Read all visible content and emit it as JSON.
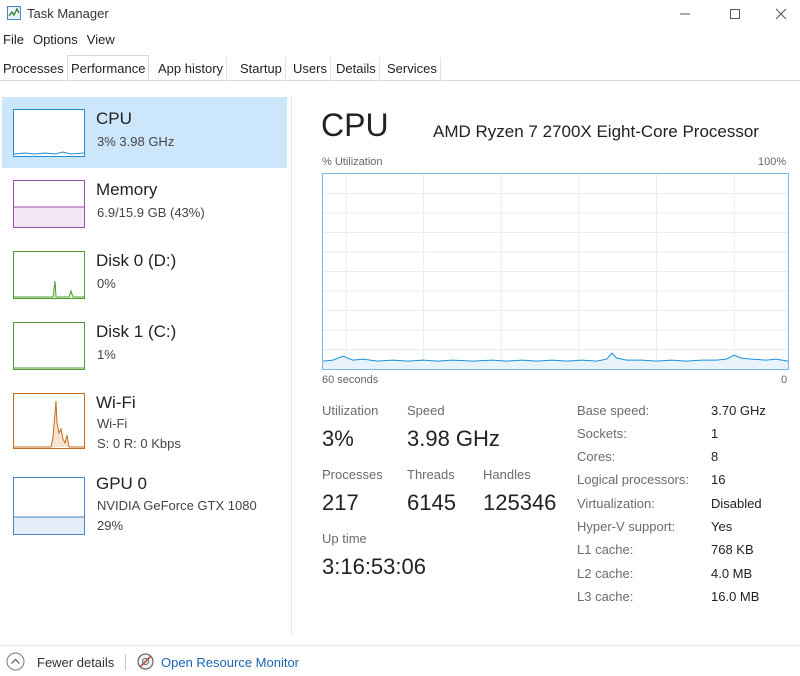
{
  "window": {
    "title": "Task Manager",
    "icons": {
      "app": "task-manager-icon",
      "minimize": "minimize-icon",
      "maximize": "maximize-icon",
      "close": "close-icon"
    }
  },
  "menu": [
    "File",
    "Options",
    "View"
  ],
  "tabs": [
    "Processes",
    "Performance",
    "App history",
    "Startup",
    "Users",
    "Details",
    "Services"
  ],
  "active_tab": "Performance",
  "sidebar": [
    {
      "title": "CPU",
      "line1": "3%  3.98 GHz",
      "line2": "",
      "line3": "",
      "color": "#1e90d6",
      "active": true
    },
    {
      "title": "Memory",
      "line1": "6.9/15.9 GB (43%)",
      "line2": "",
      "line3": "",
      "color": "#9b4ca8",
      "level": 0.43
    },
    {
      "title": "Disk 0 (D:)",
      "line1": "0%",
      "line2": "",
      "line3": "",
      "color": "#4f9b2b"
    },
    {
      "title": "Disk 1 (C:)",
      "line1": "1%",
      "line2": "",
      "line3": "",
      "color": "#4f9b2b"
    },
    {
      "title": "Wi-Fi",
      "line1": "Wi-Fi",
      "line2": "S: 0 R: 0 Kbps",
      "line3": "",
      "color": "#c86a1e"
    },
    {
      "title": "GPU 0",
      "line1": "NVIDIA GeForce GTX 1080",
      "line2": "29%",
      "line3": "",
      "color": "#4a86c8"
    }
  ],
  "main": {
    "title": "CPU",
    "processor": "AMD Ryzen 7 2700X Eight-Core Processor",
    "util_label": "% Utilization",
    "max_label": "100%",
    "time_label": "60 seconds",
    "zero_label": "0",
    "graph_color": "#1e90d6",
    "stats": {
      "utilization_label": "Utilization",
      "utilization": "3%",
      "speed_label": "Speed",
      "speed": "3.98 GHz",
      "processes_label": "Processes",
      "processes": "217",
      "threads_label": "Threads",
      "threads": "6145",
      "handles_label": "Handles",
      "handles": "125346",
      "uptime_label": "Up time",
      "uptime": "3:16:53:06"
    },
    "details": [
      {
        "key": "Base speed:",
        "value": "3.70 GHz"
      },
      {
        "key": "Sockets:",
        "value": "1"
      },
      {
        "key": "Cores:",
        "value": "8"
      },
      {
        "key": "Logical processors:",
        "value": "16"
      },
      {
        "key": "Virtualization:",
        "value": "Disabled"
      },
      {
        "key": "Hyper-V support:",
        "value": "Yes"
      },
      {
        "key": "L1 cache:",
        "value": "768 KB"
      },
      {
        "key": "L2 cache:",
        "value": "4.0 MB"
      },
      {
        "key": "L3 cache:",
        "value": "16.0 MB"
      }
    ]
  },
  "footer": {
    "fewer_details": "Fewer details",
    "open_monitor": "Open Resource Monitor",
    "icons": {
      "fewer": "chevron-up-circle-icon",
      "monitor": "resource-monitor-icon"
    }
  }
}
